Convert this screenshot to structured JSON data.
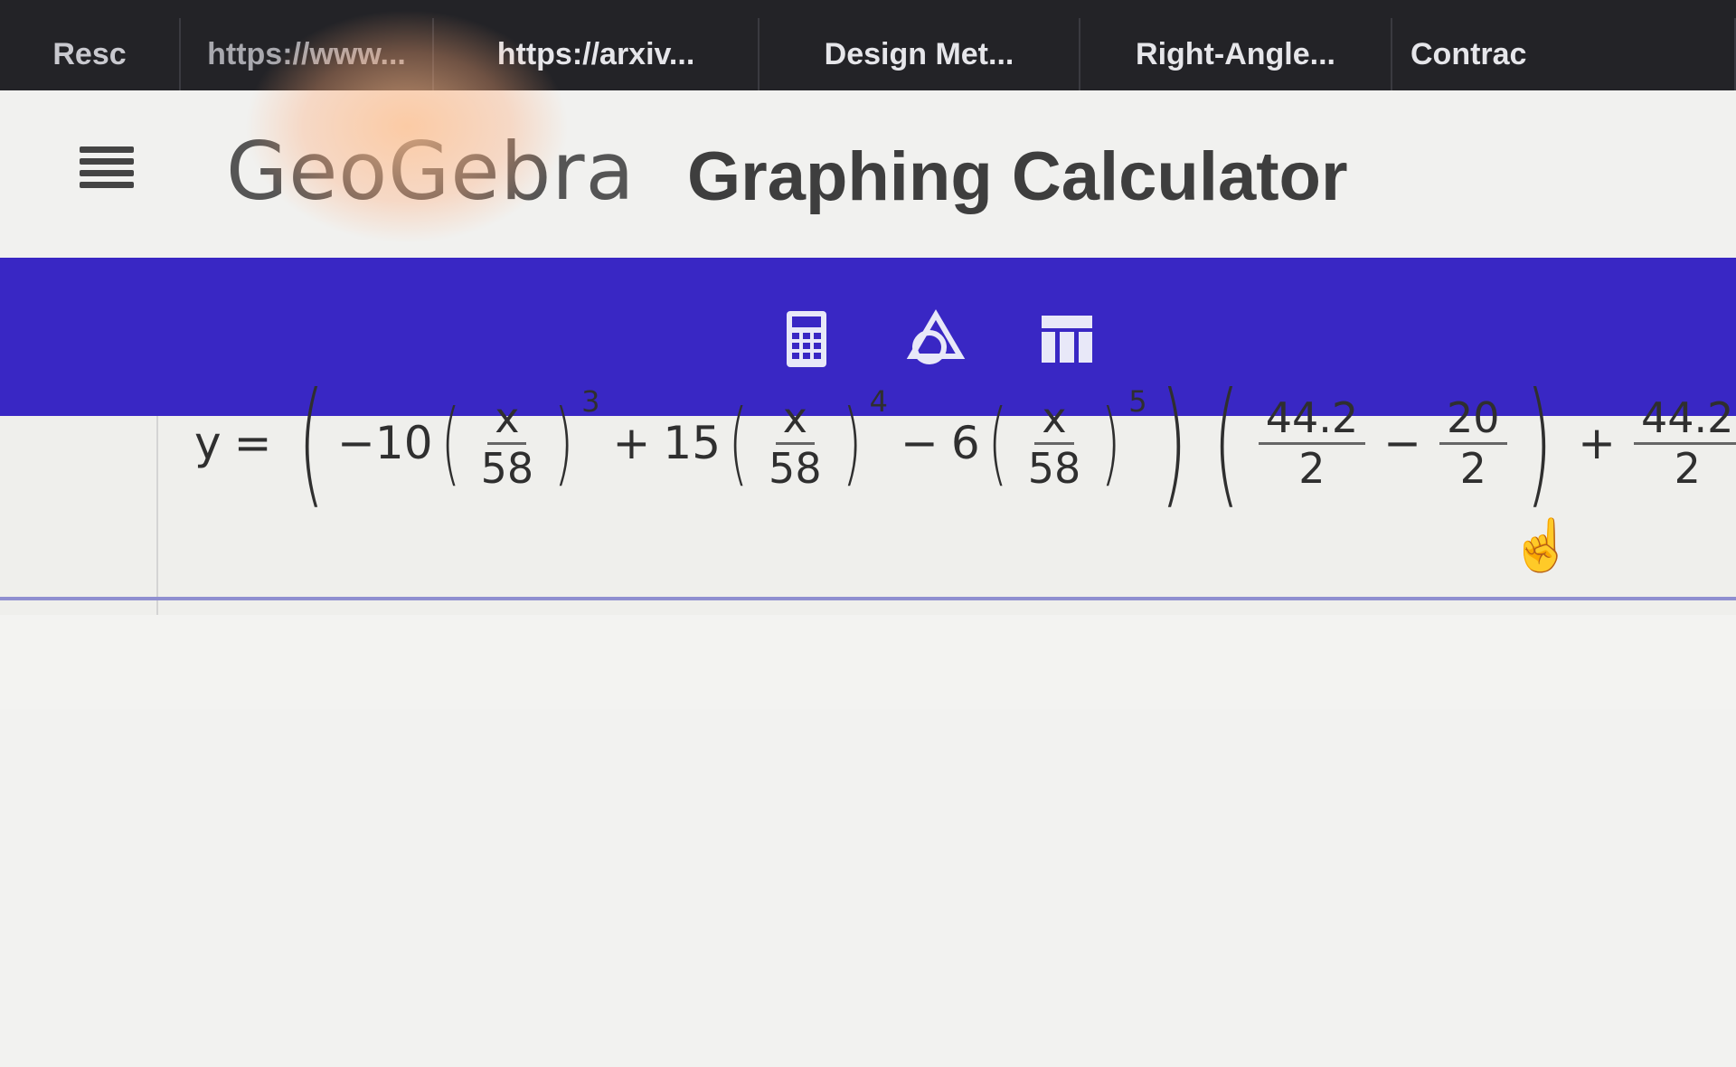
{
  "browser": {
    "tabs": [
      {
        "label": "Resc"
      },
      {
        "label": "https://www..."
      },
      {
        "label": "https://arxiv..."
      },
      {
        "label": "Design Met..."
      },
      {
        "label": "Right-Angle..."
      },
      {
        "label": "Contrac"
      }
    ]
  },
  "header": {
    "logo": "GeoGebra",
    "title": "Graphing Calculator",
    "menu_icon": "hamburger-menu-icon"
  },
  "toolbar": {
    "tools": [
      {
        "icon": "calculator-icon",
        "active": true
      },
      {
        "icon": "geometry-icon",
        "active": false
      },
      {
        "icon": "table-icon",
        "active": false
      }
    ],
    "accent": "#3927c4"
  },
  "algebra": {
    "lhs": "y",
    "eq": "=",
    "coef1": "−10",
    "frac_num": "x",
    "frac_den": "58",
    "exp1": "3",
    "plus1": "+",
    "coef2": "15",
    "exp2": "4",
    "minus1": "−",
    "coef3": "6",
    "exp3": "5",
    "f1_num": "44.2",
    "f1_den": "2",
    "minus2": "−",
    "f2_num": "20",
    "f2_den": "2",
    "plus2": "+",
    "f3_num": "44.2",
    "f3_den": "2"
  },
  "cursor_icon": "hand-pointer-icon"
}
